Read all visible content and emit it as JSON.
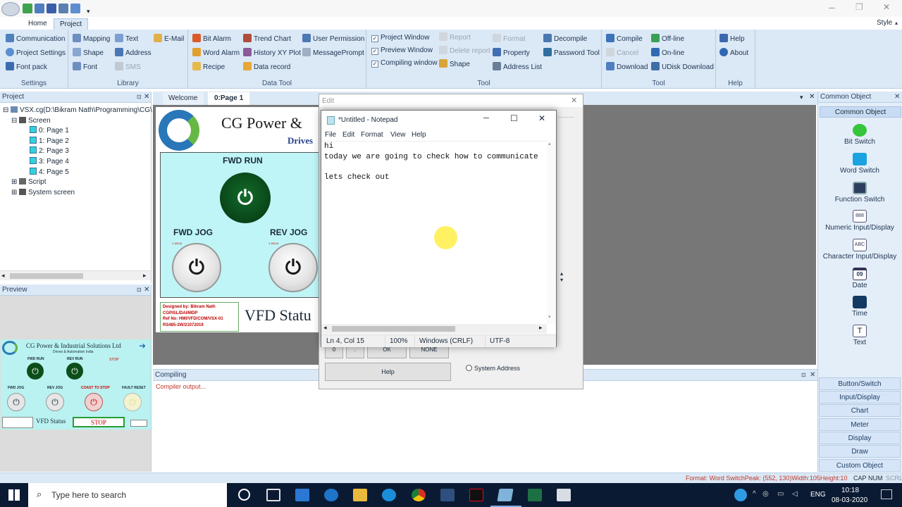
{
  "window": {
    "title_right": "Style"
  },
  "ribbon": {
    "tabs": [
      "Home",
      "Project"
    ],
    "settings": {
      "items": [
        "Communication",
        "Project Settings",
        "Font pack"
      ],
      "label": "Settings"
    },
    "library": {
      "items": [
        "Mapping",
        "Text",
        "E-Mail",
        "Shape",
        "Address",
        "Font",
        "SMS"
      ],
      "label": "Library"
    },
    "datatool": {
      "items": [
        "Bit Alarm",
        "Trend Chart",
        "User Permission",
        "Word Alarm",
        "History XY Plot",
        "MessagePrompt",
        "Recipe",
        "Data record"
      ],
      "label": "Data Tool"
    },
    "tool": {
      "items": [
        "Project Window",
        "Report",
        "Format",
        "Decompile",
        "Preview Window",
        "Delete report",
        "Property",
        "Password Tool",
        "Compiling window",
        "Shape",
        "Address List"
      ],
      "label": "Tool"
    },
    "tool2": {
      "items": [
        "Compile",
        "Off-line",
        "Cancel",
        "On-line",
        "Download",
        "UDisk Download"
      ],
      "label": "Tool"
    },
    "help": {
      "items": [
        "Help",
        "About"
      ],
      "label": "Help"
    }
  },
  "project_panel": {
    "title": "Project",
    "root": "VSX.cg(D:\\Bikram Nath\\Programming\\CG\\",
    "screen": "Screen",
    "pages": [
      "0: Page 1",
      "1: Page 2",
      "2: Page 3",
      "3: Page 4",
      "4: Page 5"
    ],
    "script": "Script",
    "system_screen": "System screen"
  },
  "preview_panel": {
    "title": "Preview",
    "company": "CG Power & Industrial Solutions Ltd",
    "sub": "Drives & Automation India",
    "labels": [
      "FWD RUN",
      "REV RUN",
      "STOP",
      "FWD JOG",
      "REV JOG",
      "COAST TO STOP",
      "FAULT RESET"
    ],
    "status": "VFD Status",
    "stop": "STOP"
  },
  "doc_tabs": [
    "Welcome",
    "0:Page 1"
  ],
  "canvas": {
    "company": "CG Power &",
    "drives": "Drives",
    "fwd_run": "FWD RUN",
    "fwd_jog": "FWD JOG",
    "rev_jog": "REV JOG",
    "small1": "1.48116",
    "small2": "1.48116",
    "designed": "Designed by:  Bikram Nath",
    "dept": "CGPISL/DAI/MDP",
    "ref": "Ref No: HMI/VFD/COM/VSX-01",
    "rs": "RS485-2W/21072019",
    "vfd_status": "VFD Statu"
  },
  "edit_dialog": {
    "title": "Edit",
    "keys": [
      "0",
      ".",
      "OK",
      "NONE"
    ],
    "help": "Help",
    "sysaddr": "System Address"
  },
  "notepad": {
    "title": "*Untitled - Notepad",
    "menu": [
      "File",
      "Edit",
      "Format",
      "View",
      "Help"
    ],
    "lines": [
      "hi",
      "today we are going to check how to communicate",
      "",
      "lets check out"
    ],
    "status": [
      "Ln 4, Col 15",
      "100%",
      "Windows (CRLF)",
      "UTF-8"
    ]
  },
  "compiling": {
    "title": "Compiling",
    "text": "Compiler output..."
  },
  "common_object": {
    "title": "Common Object",
    "tab": "Common Object",
    "items": [
      "Bit Switch",
      "Word Switch",
      "Function Switch",
      "Numeric Input/Display",
      "Character Input/Display",
      "Date",
      "Time",
      "Text"
    ],
    "date_glyph": "09",
    "cats": [
      "Button/Switch",
      "Input/Display",
      "Chart",
      "Meter",
      "Display",
      "Draw",
      "Custom Object"
    ]
  },
  "statusbar": {
    "text": "Format: Word SwitchPeak: (552, 130)Width:105Height:10",
    "cap": "CAP",
    "num": "NUM",
    "scrl": "SCRL"
  },
  "taskbar": {
    "search": "Type here to search",
    "lang": "ENG",
    "time": "10:18",
    "date": "08-03-2020"
  }
}
